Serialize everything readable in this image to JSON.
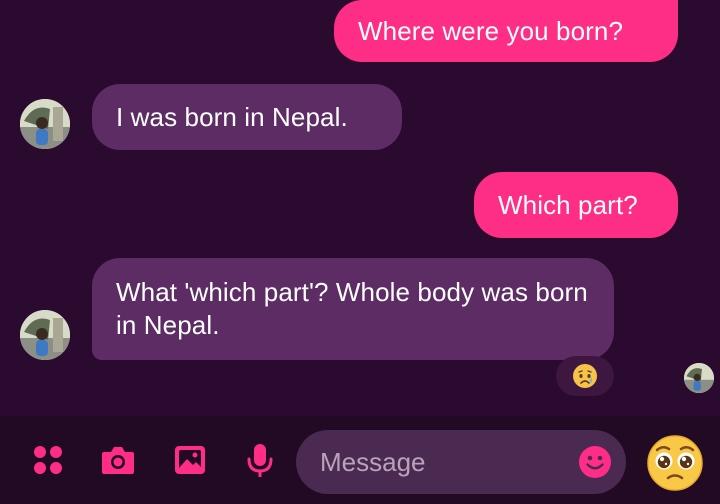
{
  "messages": [
    {
      "from": "me",
      "text": "Where were you born?"
    },
    {
      "from": "them",
      "text": "I was born in Nepal."
    },
    {
      "from": "me",
      "text": "Which part?"
    },
    {
      "from": "them",
      "text": "What 'which part'? Whole body was born in Nepal."
    }
  ],
  "reaction": {
    "icon": "crying-face-emoji"
  },
  "composer": {
    "placeholder": "Message",
    "value": "",
    "icons": [
      "menu-dots-icon",
      "camera-icon",
      "gallery-icon",
      "microphone-icon",
      "emoji-icon",
      "pleading-face-emoji"
    ]
  },
  "colors": {
    "background": "#2a0a2f",
    "outgoing_bubble": "#fe2d85",
    "incoming_bubble": "#5d2c64",
    "accent": "#ff2d87",
    "composer_bg": "#220924",
    "input_bg": "#4b2a52"
  }
}
